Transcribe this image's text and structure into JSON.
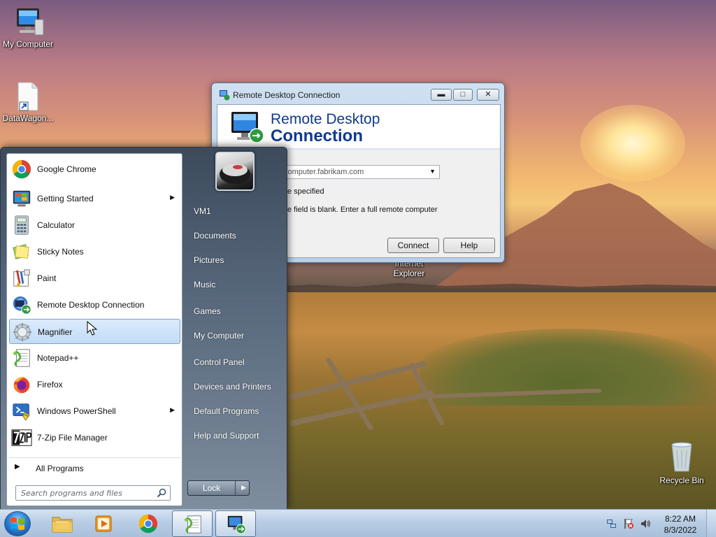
{
  "desktop": {
    "icons": [
      {
        "label": "My Computer"
      },
      {
        "label": "DataWagon..."
      },
      {
        "label": "Internet Explorer"
      },
      {
        "label": "Recycle Bin"
      }
    ]
  },
  "rdc_window": {
    "title": "Remote Desktop Connection",
    "banner_line1": "Remote Desktop",
    "banner_line2": "Connection",
    "computer_placeholder": "mple: computer.fabrikam.com",
    "status_line1": "e specified",
    "status_line2": "e field is blank. Enter a full remote computer",
    "connect_label": "Connect",
    "help_label": "Help"
  },
  "start_menu": {
    "programs": [
      {
        "label": "Google Chrome",
        "icon": "chrome-icon",
        "submenu": false
      },
      {
        "label": "Getting Started",
        "icon": "getting-started-icon",
        "submenu": true
      },
      {
        "label": "Calculator",
        "icon": "calculator-icon",
        "submenu": false
      },
      {
        "label": "Sticky Notes",
        "icon": "sticky-notes-icon",
        "submenu": false
      },
      {
        "label": "Paint",
        "icon": "paint-icon",
        "submenu": false
      },
      {
        "label": "Remote Desktop Connection",
        "icon": "remote-desktop-icon",
        "submenu": false
      },
      {
        "label": "Magnifier",
        "icon": "magnifier-icon",
        "submenu": false,
        "highlighted": true
      },
      {
        "label": "Notepad++",
        "icon": "notepad-plus-plus-icon",
        "submenu": false
      },
      {
        "label": "Firefox",
        "icon": "firefox-icon",
        "submenu": false
      },
      {
        "label": "Windows PowerShell",
        "icon": "powershell-icon",
        "submenu": true
      },
      {
        "label": "7-Zip File Manager",
        "icon": "seven-zip-icon",
        "submenu": false
      }
    ],
    "all_programs": "All Programs",
    "search_placeholder": "Search programs and files",
    "right_links": [
      {
        "label": "VM1"
      },
      {
        "label": "Documents"
      },
      {
        "label": "Pictures"
      },
      {
        "label": "Music"
      },
      {
        "label": "Games"
      },
      {
        "label": "My Computer"
      },
      {
        "label": "Control Panel"
      },
      {
        "label": "Devices and Printers"
      },
      {
        "label": "Default Programs"
      },
      {
        "label": "Help and Support"
      }
    ],
    "lock_label": "Lock"
  },
  "taskbar": {
    "pinned": [
      {
        "icon": "windows-explorer-icon"
      },
      {
        "icon": "media-player-icon"
      },
      {
        "icon": "chrome-icon"
      },
      {
        "icon": "notepad-plus-plus-icon"
      },
      {
        "icon": "remote-desktop-icon"
      }
    ],
    "clock_time": "8:22 AM",
    "clock_date": "8/3/2022"
  },
  "colors": {
    "accent": "#103a8c",
    "start_menu": "#4a5a6e",
    "highlight": "#c2dcf6"
  }
}
